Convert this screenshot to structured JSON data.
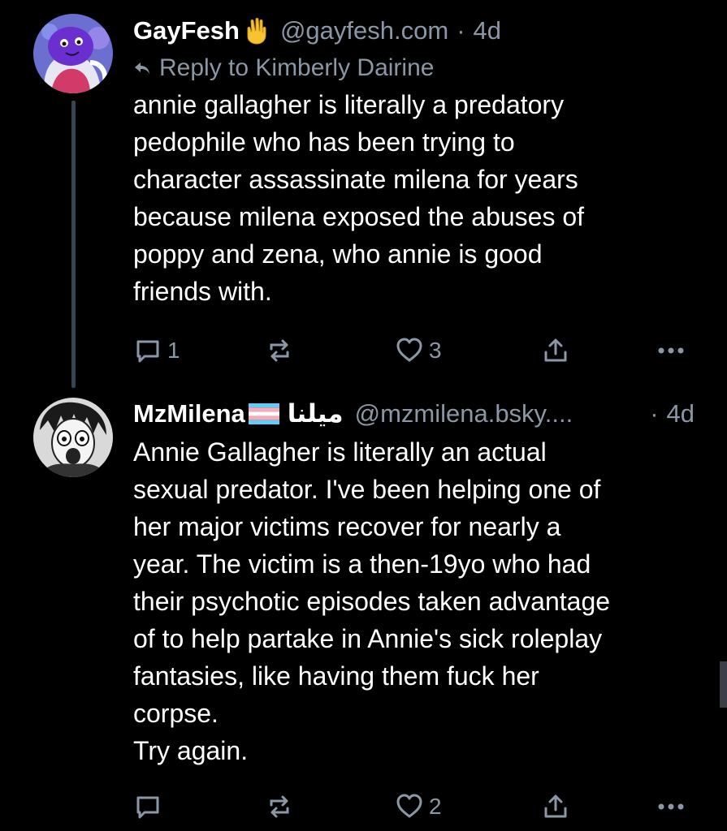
{
  "colors": {
    "background": "#000000",
    "text": "#ffffff",
    "muted": "#8c97a6",
    "thread_line": "#3a4350"
  },
  "posts": [
    {
      "display_name": "GayFesh",
      "emoji": "vulcan-salute-emoji",
      "handle": "@gayfesh.com",
      "separator": "·",
      "time": "4d",
      "reply_to": "Reply to Kimberly Dairine",
      "text": "annie gallagher is literally a predatory\npedophile who has been trying to\ncharacter assassinate milena for years\nbecause milena exposed the abuses of\npoppy and zena, who annie is good\nfriends with.",
      "reply_count": "1",
      "repost_count": "",
      "like_count": "3"
    },
    {
      "display_name": "MzMilena",
      "emoji": "transgender-flag-emoji",
      "name_suffix": "ميلنا",
      "handle": "@mzmilena.bsky....",
      "separator": "·",
      "time": "4d",
      "text": "Annie Gallagher is literally an actual\nsexual predator. I've been helping one of\nher major victims recover for nearly a\nyear. The victim is a then-19yo who had\ntheir psychotic episodes taken advantage\nof to help partake in Annie's sick roleplay\nfantasies, like having them fuck her\ncorpse.\nTry again.",
      "reply_count": "",
      "repost_count": "",
      "like_count": "2"
    }
  ]
}
